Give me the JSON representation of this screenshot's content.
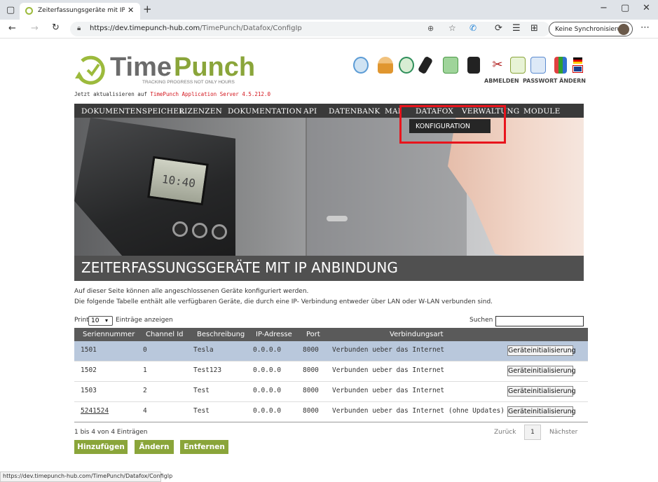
{
  "browser": {
    "tab_title": "Zeiterfassungsgeräte mit IP Anbi",
    "url_host": "https://dev.timepunch-hub.com",
    "url_path": "/TimePunch/Datafox/ConfigIp",
    "sync_label": "Keine Synchronisierung",
    "status_url": "https://dev.timepunch-hub.com/TimePunch/Datafox/ConfigIp"
  },
  "header": {
    "logo_time": "Time",
    "logo_punch": "Punch",
    "tagline": "TRACKING PROGRESS NOT ONLY HOURS",
    "update_prefix": "Jetzt aktualisieren auf ",
    "update_link": "TimePunch Application Server 4.5.212.0",
    "abmelden": "ABMELDEN",
    "passwort": "PASSWORT ÄNDERN"
  },
  "nav": {
    "items": [
      "DOKUMENTENSPEICHER",
      "LIZENZEN",
      "DOKUMENTATION",
      "API",
      "DATENBANK",
      "MAI",
      "DATAFOX",
      "VERWALTUNG",
      "MODULE"
    ],
    "dropdown_item": "KONFIGURATION"
  },
  "hero": {
    "title": "ZEITERFASSUNGSGERÄTE MIT IP ANBINDUNG",
    "display_text": "10:40"
  },
  "intro": {
    "line1": "Auf dieser Seite können alle angeschlossenen Geräte konfiguriert werden.",
    "line2": "Die folgende Tabelle enthält alle verfügbaren Geräte, die durch eine IP- Verbindung entweder über LAN oder W-LAN verbunden sind."
  },
  "table_controls": {
    "print_label": "Print",
    "page_size": "10",
    "entries_label": "Einträge anzeigen",
    "search_label": "Suchen",
    "search_value": ""
  },
  "table": {
    "headers": [
      "Seriennummer",
      "Channel Id",
      "Beschreibung",
      "IP-Adresse",
      "Port",
      "Verbindungsart"
    ],
    "rows": [
      {
        "serial": "1501",
        "channel": "0",
        "desc": "Tesla",
        "ip": "0.0.0.0",
        "port": "8000",
        "conn": "Verbunden ueber das Internet",
        "action": "Geräteinitialisierung"
      },
      {
        "serial": "1502",
        "channel": "1",
        "desc": "Test123",
        "ip": "0.0.0.0",
        "port": "8000",
        "conn": "Verbunden ueber das Internet",
        "action": "Geräteinitialisierung"
      },
      {
        "serial": "1503",
        "channel": "2",
        "desc": "Test",
        "ip": "0.0.0.0",
        "port": "8000",
        "conn": "Verbunden ueber das Internet",
        "action": "Geräteinitialisierung"
      },
      {
        "serial": "5241524",
        "channel": "4",
        "desc": "Test",
        "ip": "0.0.0.0",
        "port": "8000",
        "conn": "Verbunden ueber das Internet (ohne Updates)",
        "action": "Geräteinitialisierung"
      }
    ]
  },
  "pagination": {
    "info": "1 bis 4 von 4 Einträgen",
    "prev": "Zurück",
    "page": "1",
    "next": "Nächster"
  },
  "actions": {
    "add": "Hinzufügen",
    "edit": "Ändern",
    "remove": "Entfernen"
  },
  "colors": {
    "accent_green": "#8aa53a",
    "nav_bg": "#3a3a3a",
    "highlight_red": "#e8141c",
    "row_selected": "#b9c8dc"
  }
}
